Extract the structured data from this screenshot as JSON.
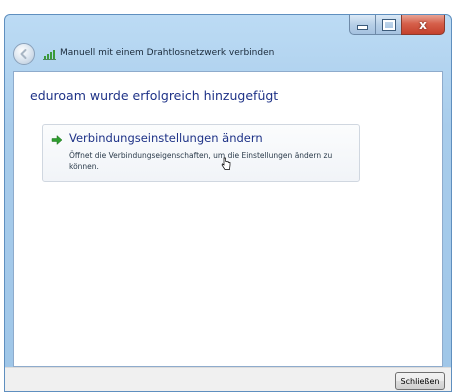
{
  "window": {
    "title": "Manuell mit einem Drahtlosnetzwerk verbinden",
    "controls": {
      "minimize_icon": "minimize-icon",
      "maximize_icon": "maximize-icon",
      "close_icon": "close-icon",
      "close_glyph": "x"
    }
  },
  "content": {
    "heading": "eduroam wurde erfolgreich hinzugefügt",
    "command_link": {
      "title": "Verbindungseinstellungen ändern",
      "description": "Öffnet die Verbindungseigenschaften, um die Einstellungen ändern zu können.",
      "icon": "green-arrow-icon"
    }
  },
  "footer": {
    "close_label": "Schließen"
  },
  "colors": {
    "heading": "#1e3287",
    "frame": "#a8cceb",
    "close_button_red": "#d6604b",
    "arrow_green": "#2e9e2e"
  }
}
